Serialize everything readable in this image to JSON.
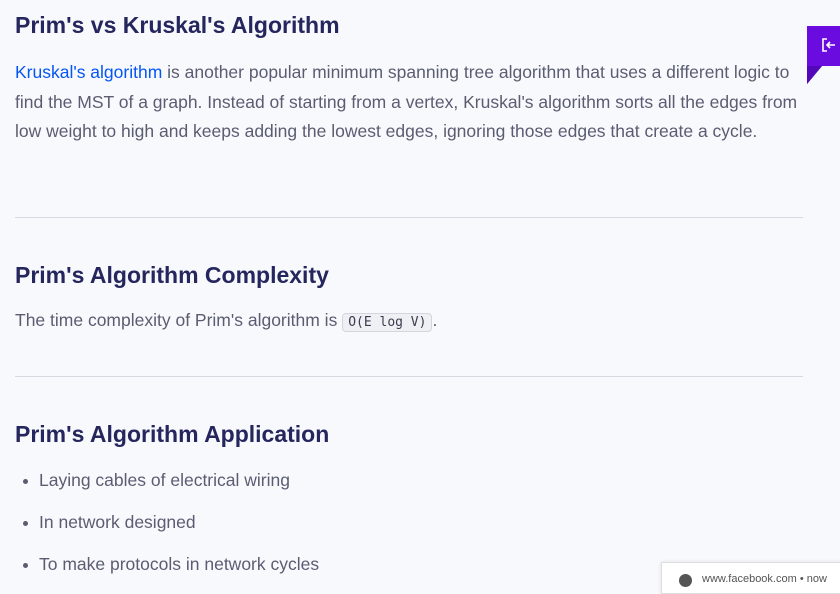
{
  "sections": [
    {
      "title": "Prim's vs Kruskal's Algorithm",
      "link": "Kruskal's algorithm",
      "text": " is another popular minimum spanning tree algorithm that uses a different logic to find the MST of a graph. Instead of starting from a vertex, Kruskal's algorithm sorts all the edges from low weight to high and keeps adding the lowest edges, ignoring those edges that create a cycle."
    },
    {
      "title": "Prim's Algorithm Complexity",
      "text_before": "The time complexity of Prim's algorithm is ",
      "code": "O(E log V)",
      "text_after": "."
    },
    {
      "title": "Prim's Algorithm Application",
      "items": [
        "Laying cables of electrical wiring",
        "In network designed",
        "To make protocols in network cycles"
      ]
    }
  ],
  "side_tab": {
    "icon": "exit-icon",
    "color": "#6a0be0"
  },
  "notification": {
    "text": "www.facebook.com  •  now"
  }
}
